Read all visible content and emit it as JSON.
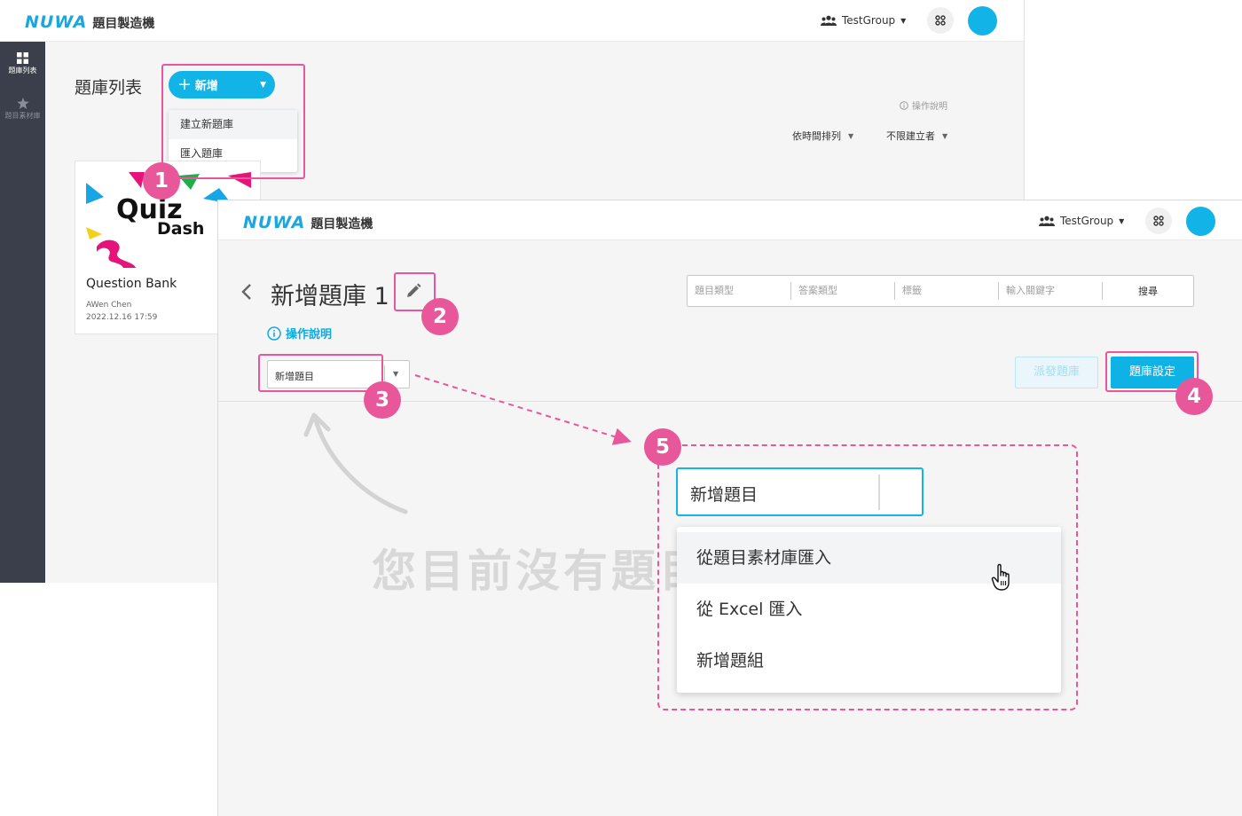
{
  "app": {
    "logo": "NUWA",
    "app_name": "題目製造機",
    "group": "TestGroup"
  },
  "bank_list_window": {
    "sidebar": [
      {
        "label": "題庫列表",
        "icon": "grid-icon",
        "active": true
      },
      {
        "label": "題目素材庫",
        "icon": "star-icon",
        "active": false
      }
    ],
    "title": "題庫列表",
    "new_button": "新增",
    "new_menu": [
      "建立新題庫",
      "匯入題庫"
    ],
    "help_link": "操作說明",
    "sort_order": "依時間排列",
    "creator_filter": "不限建立者",
    "card": {
      "image_text_1": "Quiz",
      "image_text_2": "Dash",
      "title": "Question Bank",
      "author": "AWen Chen",
      "date": "2022.12.16 17:59"
    }
  },
  "bank_edit_window": {
    "title": "新增題庫 1",
    "help_link": "操作說明",
    "filters": [
      "題目類型",
      "答案類型",
      "標籤",
      "輸入關鍵字"
    ],
    "search_button": "搜尋",
    "add_question_select": "新增題目",
    "dispatch_button": "派發題庫",
    "settings_button": "題庫設定",
    "empty_message": "您目前沒有題目"
  },
  "zoom_dropdown": {
    "selected": "新增題目",
    "options": [
      "從題目素材庫匯入",
      "從 Excel 匯入",
      "新增題組"
    ]
  },
  "annotations": {
    "badges": [
      "1",
      "2",
      "3",
      "4",
      "5"
    ],
    "color": "#e8579a"
  },
  "colors": {
    "accent": "#12b3e6",
    "sidebar": "#3b3f4b",
    "annotation": "#e8579a"
  }
}
